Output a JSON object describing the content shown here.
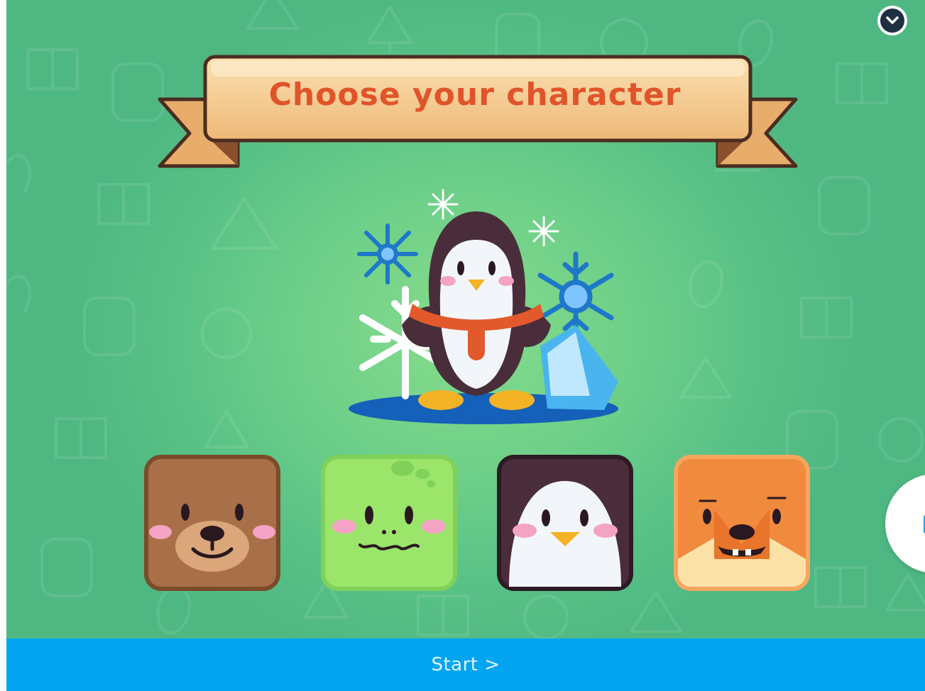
{
  "banner": {
    "title": "Choose your character"
  },
  "hero": {
    "character": "penguin",
    "icon": "penguin-with-snowflakes-illustration"
  },
  "characters": [
    {
      "id": "bear",
      "icon": "bear-face-icon",
      "color": "#a86f48"
    },
    {
      "id": "frog",
      "icon": "frog-face-icon",
      "color": "#9be56a"
    },
    {
      "id": "penguin",
      "icon": "penguin-face-icon",
      "color": "#4a2d3a"
    },
    {
      "id": "fox",
      "icon": "fox-face-icon",
      "color": "#f08a3c"
    }
  ],
  "controls": {
    "collapse_icon": "chevron-down-icon",
    "next_icon": "play-arrow-icon",
    "start_label": "Start >"
  },
  "colors": {
    "background": "#5fc587",
    "start_bar": "#04a5f0",
    "title_text": "#e0542a",
    "banner": "#f4c88f"
  }
}
